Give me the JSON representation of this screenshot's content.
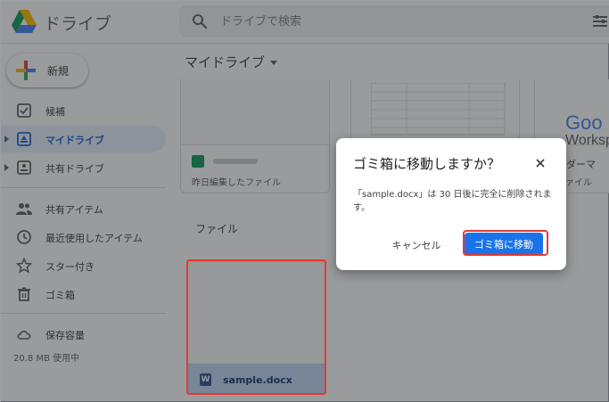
{
  "header": {
    "app_title": "ドライブ",
    "search_placeholder": "ドライブで検索",
    "logo_icon": "google-drive-logo",
    "search_icon": "search-icon",
    "filter_icon": "tune-icon"
  },
  "sidebar": {
    "new_label": "新規",
    "items": [
      {
        "label": "候補",
        "icon": "check-box-icon"
      },
      {
        "label": "マイドライブ",
        "icon": "my-drive-icon",
        "active": true
      },
      {
        "label": "共有ドライブ",
        "icon": "shared-drive-icon"
      },
      {
        "label": "共有アイテム",
        "icon": "people-icon"
      },
      {
        "label": "最近使用したアイテム",
        "icon": "clock-icon"
      },
      {
        "label": "スター付き",
        "icon": "star-icon"
      },
      {
        "label": "ゴミ箱",
        "icon": "trash-icon"
      },
      {
        "label": "保存容量",
        "icon": "cloud-icon"
      }
    ],
    "storage_used": "20.8 MB 使用中"
  },
  "main": {
    "breadcrumb": "マイドライブ",
    "suggested_cards": [
      {
        "subtitle": "昨日編集したファイル"
      },
      {
        "subtitle": ""
      },
      {
        "subtitle": "ンダーマ",
        "subtitle2": "ファイル",
        "preview_text": "Goo",
        "preview_text2": "Worksp"
      }
    ],
    "files_section_label": "ファイル",
    "files": [
      {
        "name": "sample.docx",
        "icon_letter": "W"
      }
    ]
  },
  "dialog": {
    "title": "ゴミ箱に移動しますか？",
    "message": "「sample.docx」は 30 日後に完全に削除されます。",
    "cancel_label": "キャンセル",
    "confirm_label": "ゴミ箱に移動"
  },
  "colors": {
    "accent": "#1a73e8",
    "active_nav_bg": "#e8f0fe",
    "highlight": "#e53935"
  }
}
